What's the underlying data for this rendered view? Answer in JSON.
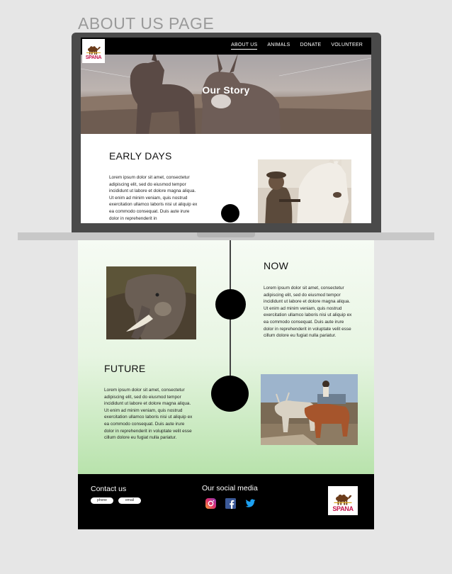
{
  "page_heading": "ABOUT US PAGE",
  "logo": {
    "text": "SPANA"
  },
  "nav": {
    "items": [
      "ABOUT US",
      "ANIMALS",
      "DONATE",
      "VOLUNTEER"
    ]
  },
  "hero": {
    "title": "Our Story"
  },
  "sections": {
    "early": {
      "heading": "EARLY DAYS",
      "text": "Lorem ipsum dolor sit amet, consectetur adipiscing elit, sed do eiusmod tempor incididunt ut labore et dolore magna aliqua. Ut enim ad minim veniam, quis nostrud exercitation ullamco laboris nisi ut aliquip ex ea commodo consequat. Duis aute irure dolor in reprehenderit in"
    },
    "now": {
      "heading": "NOW",
      "text": "Lorem ipsum dolor sit amet, consectetur adipiscing elit, sed do eiusmod tempor incididunt ut labore et dolore magna aliqua. Ut enim ad minim veniam, quis nostrud exercitation ullamco laboris nisi ut aliquip ex ea commodo consequat. Duis aute irure dolor in reprehenderit in voluptate velit esse cillum dolore eu fugiat nulla pariatur."
    },
    "future": {
      "heading": "FUTURE",
      "text": "Lorem ipsum dolor sit amet, consectetur adipiscing elit, sed do eiusmod tempor incididunt ut labore et dolore magna aliqua. Ut enim ad minim veniam, quis nostrud exercitation ullamco laboris nisi ut aliquip ex ea commodo consequat. Duis aute irure dolor in reprehenderit in voluptate velit esse cillum dolore eu fugiat nulla pariatur."
    }
  },
  "footer": {
    "contact_title": "Contact us",
    "phone_label": "phone",
    "email_label": "email",
    "social_title": "Our social media",
    "social_icons": [
      "instagram-icon",
      "facebook-icon",
      "twitter-icon"
    ]
  },
  "colors": {
    "nav_bg": "#000000",
    "footer_bg": "#000000",
    "logo_red": "#c4144b",
    "gradient_green": "#9fd691"
  }
}
